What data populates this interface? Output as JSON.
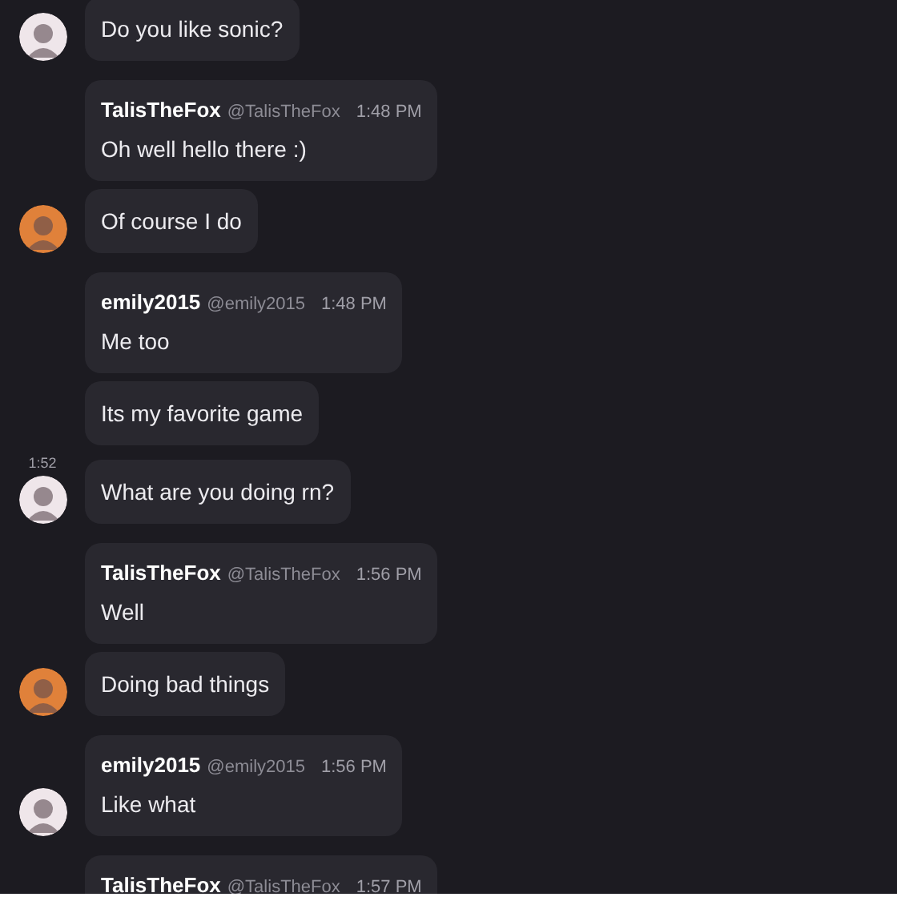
{
  "messages": [
    {
      "text": "Do you like sonic?",
      "avatar": {
        "color": "#efe6ea"
      }
    },
    {
      "author": "TalisTheFox",
      "handle": "@TalisTheFox",
      "time": "1:48 PM",
      "text": "Oh well hello there :)"
    },
    {
      "text": "Of course I do",
      "avatar": {
        "color": "#e0813a"
      }
    },
    {
      "author": "emily2015",
      "handle": "@emily2015",
      "time": "1:48 PM",
      "text": "Me too"
    },
    {
      "text": "Its my favorite game"
    },
    {
      "side_time": "1:52",
      "text": "What are you doing rn?",
      "avatar": {
        "color": "#efe6ea"
      }
    },
    {
      "author": "TalisTheFox",
      "handle": "@TalisTheFox",
      "time": "1:56 PM",
      "text": "Well"
    },
    {
      "text": "Doing bad things",
      "avatar": {
        "color": "#e0813a"
      }
    },
    {
      "author": "emily2015",
      "handle": "@emily2015",
      "time": "1:56 PM",
      "text": "Like what",
      "avatar": {
        "color": "#efe6ea"
      }
    },
    {
      "author": "TalisTheFox",
      "handle": "@TalisTheFox",
      "time": "1:57 PM"
    }
  ]
}
